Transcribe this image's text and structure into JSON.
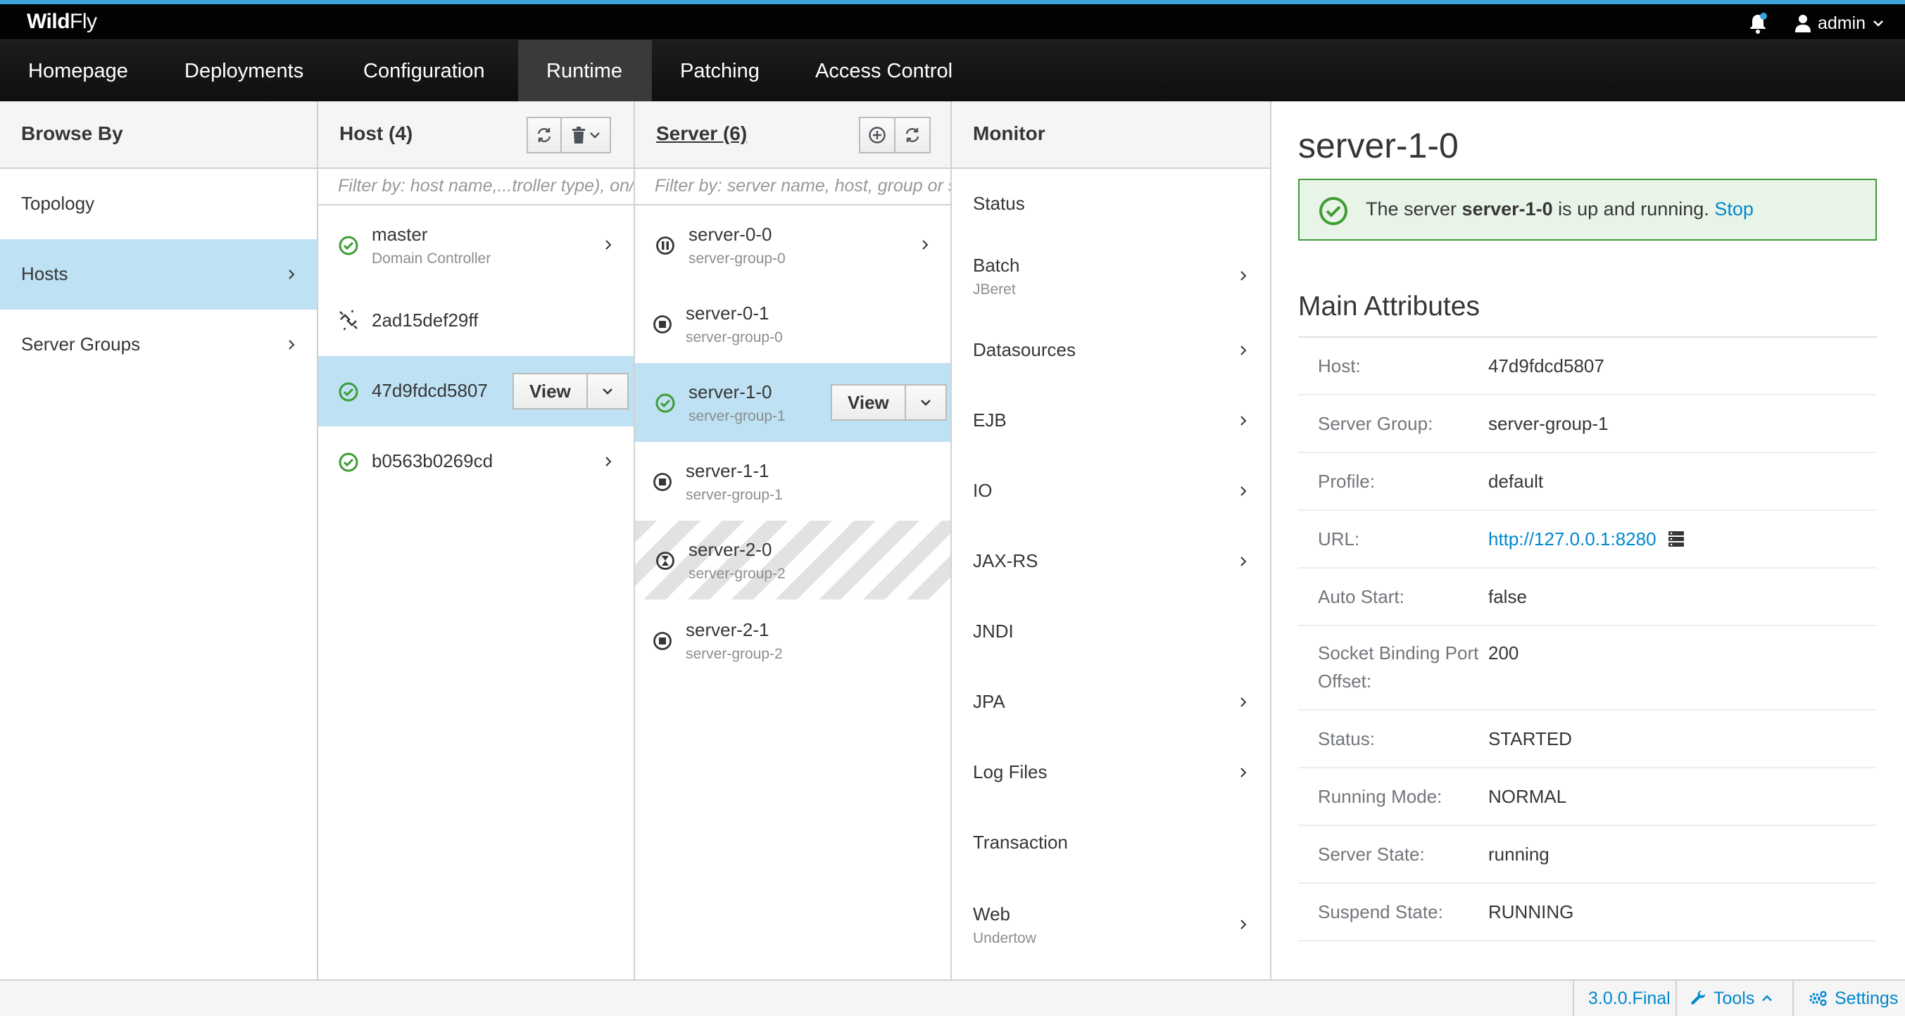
{
  "app": {
    "brand_bold": "Wild",
    "brand_rest": "Fly"
  },
  "header": {
    "user": "admin"
  },
  "nav": [
    "Homepage",
    "Deployments",
    "Configuration",
    "Runtime",
    "Patching",
    "Access Control"
  ],
  "browse": {
    "title": "Browse By",
    "items": [
      "Topology",
      "Hosts",
      "Server Groups"
    ]
  },
  "hosts": {
    "title": "Host (4)",
    "filter_placeholder": "Filter by: host name,...troller type), on/o",
    "items": [
      {
        "name": "master",
        "sub": "Domain Controller",
        "status": "ok"
      },
      {
        "name": "2ad15def29ff",
        "sub": "",
        "status": "disconnected"
      },
      {
        "name": "47d9fdcd5807",
        "sub": "",
        "status": "ok"
      },
      {
        "name": "b0563b0269cd",
        "sub": "",
        "status": "ok"
      }
    ],
    "view_label": "View"
  },
  "servers": {
    "title": "Server (6)",
    "filter_placeholder": "Filter by: server name, host, group or s",
    "items": [
      {
        "name": "server-0-0",
        "sub": "server-group-0",
        "status": "paused"
      },
      {
        "name": "server-0-1",
        "sub": "server-group-0",
        "status": "stopped"
      },
      {
        "name": "server-1-0",
        "sub": "server-group-1",
        "status": "ok"
      },
      {
        "name": "server-1-1",
        "sub": "server-group-1",
        "status": "stopped"
      },
      {
        "name": "server-2-0",
        "sub": "server-group-2",
        "status": "pending"
      },
      {
        "name": "server-2-1",
        "sub": "server-group-2",
        "status": "stopped"
      }
    ],
    "view_label": "View"
  },
  "monitor": {
    "title": "Monitor",
    "items": [
      {
        "name": "Status",
        "sub": ""
      },
      {
        "name": "Batch",
        "sub": "JBeret"
      },
      {
        "name": "Datasources",
        "sub": ""
      },
      {
        "name": "EJB",
        "sub": ""
      },
      {
        "name": "IO",
        "sub": ""
      },
      {
        "name": "JAX-RS",
        "sub": ""
      },
      {
        "name": "JNDI",
        "sub": ""
      },
      {
        "name": "JPA",
        "sub": ""
      },
      {
        "name": "Log Files",
        "sub": ""
      },
      {
        "name": "Transaction",
        "sub": ""
      },
      {
        "name": "Web",
        "sub": "Undertow"
      }
    ]
  },
  "details": {
    "title": "server-1-0",
    "alert": {
      "prefix": "The server ",
      "server": "server-1-0",
      "suffix": " is up and running. ",
      "action": "Stop"
    },
    "section": "Main Attributes",
    "attributes": [
      {
        "label": "Host:",
        "value": "47d9fdcd5807"
      },
      {
        "label": "Server Group:",
        "value": "server-group-1"
      },
      {
        "label": "Profile:",
        "value": "default"
      },
      {
        "label": "URL:",
        "value": "http://127.0.0.1:8280"
      },
      {
        "label": "Auto Start:",
        "value": "false"
      },
      {
        "label": "Socket Binding Port",
        "label2": "Offset:",
        "value": "200"
      },
      {
        "label": "Status:",
        "value": "STARTED"
      },
      {
        "label": "Running Mode:",
        "value": "NORMAL"
      },
      {
        "label": "Server State:",
        "value": "running"
      },
      {
        "label": "Suspend State:",
        "value": "RUNNING"
      }
    ]
  },
  "footer": {
    "version": "3.0.0.Final",
    "tools": "Tools",
    "settings": "Settings"
  },
  "colors": {
    "accent": "#0088ce",
    "selected": "#bee1f4",
    "success": "#3f9c35",
    "topline": "#39a5dc"
  }
}
